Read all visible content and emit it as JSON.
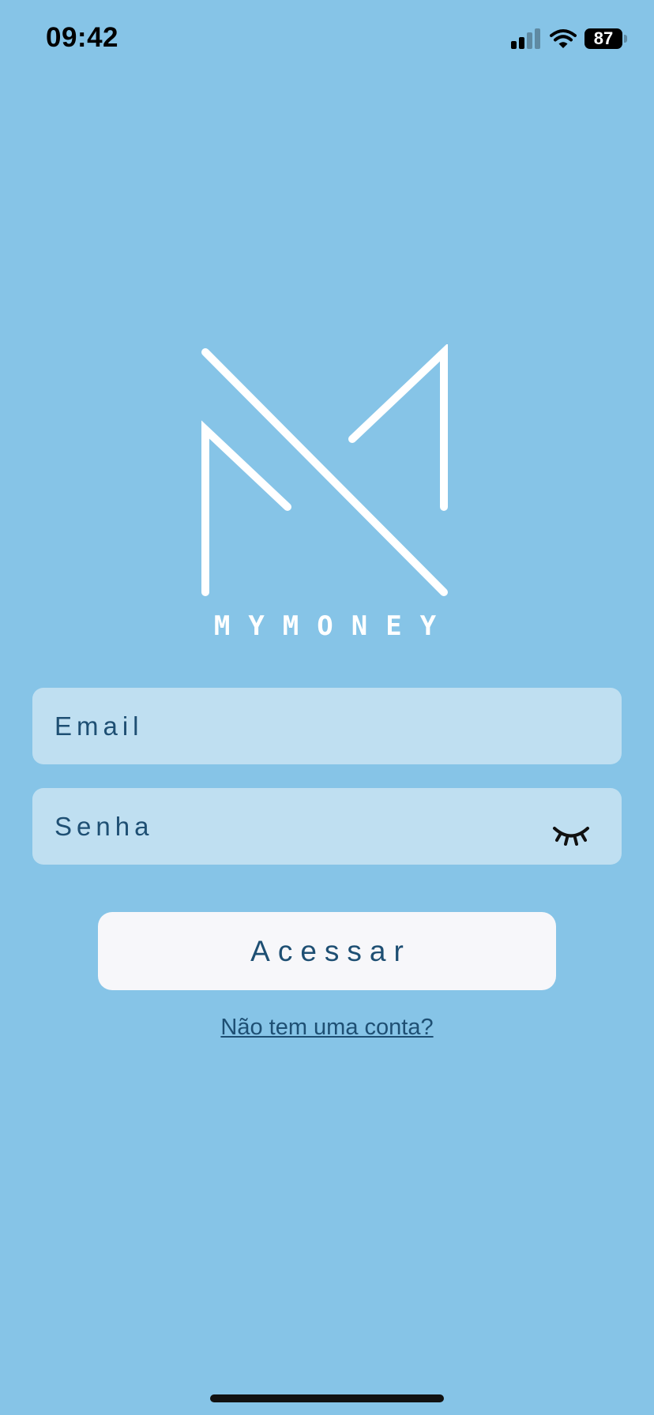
{
  "status_bar": {
    "time": "09:42",
    "battery_level": "87",
    "signal_icon": "cellular-signal-icon",
    "wifi_icon": "wifi-icon"
  },
  "logo": {
    "wordmark": "MYMONEY",
    "icon": "mymoney-logo-mark"
  },
  "form": {
    "email_placeholder": "Email",
    "password_placeholder": "Senha",
    "password_toggle_icon": "eye-closed-icon",
    "submit_label": "Acessar",
    "signup_link": "Não tem uma conta?"
  },
  "colors": {
    "background": "#86c4e7",
    "input_background": "#bfdff1",
    "text_primary": "#1e4f73",
    "button_background": "#f7f7fa"
  }
}
